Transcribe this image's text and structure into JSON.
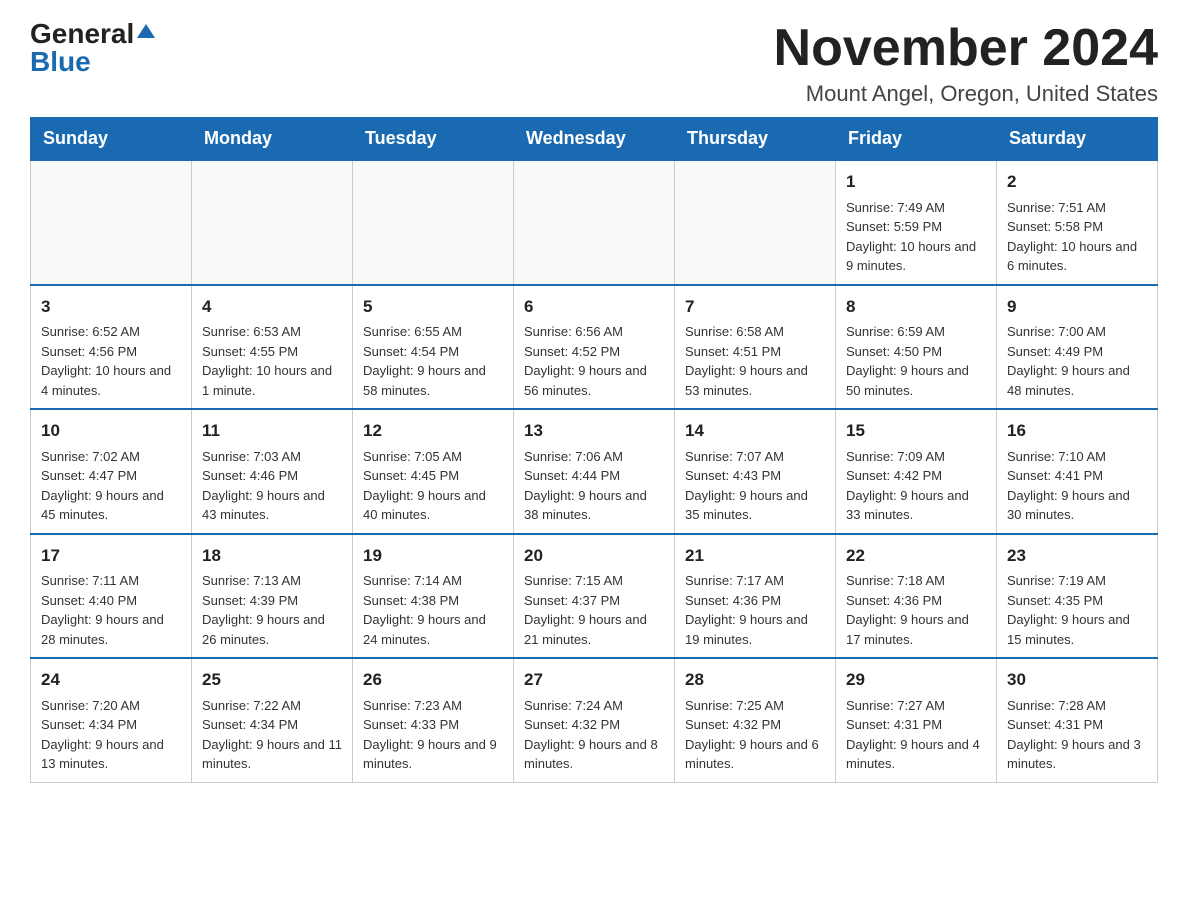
{
  "header": {
    "logo": {
      "general": "General",
      "blue": "Blue"
    },
    "month_title": "November 2024",
    "location": "Mount Angel, Oregon, United States"
  },
  "weekdays": [
    "Sunday",
    "Monday",
    "Tuesday",
    "Wednesday",
    "Thursday",
    "Friday",
    "Saturday"
  ],
  "weeks": [
    [
      {
        "day": "",
        "info": ""
      },
      {
        "day": "",
        "info": ""
      },
      {
        "day": "",
        "info": ""
      },
      {
        "day": "",
        "info": ""
      },
      {
        "day": "",
        "info": ""
      },
      {
        "day": "1",
        "info": "Sunrise: 7:49 AM\nSunset: 5:59 PM\nDaylight: 10 hours and 9 minutes."
      },
      {
        "day": "2",
        "info": "Sunrise: 7:51 AM\nSunset: 5:58 PM\nDaylight: 10 hours and 6 minutes."
      }
    ],
    [
      {
        "day": "3",
        "info": "Sunrise: 6:52 AM\nSunset: 4:56 PM\nDaylight: 10 hours and 4 minutes."
      },
      {
        "day": "4",
        "info": "Sunrise: 6:53 AM\nSunset: 4:55 PM\nDaylight: 10 hours and 1 minute."
      },
      {
        "day": "5",
        "info": "Sunrise: 6:55 AM\nSunset: 4:54 PM\nDaylight: 9 hours and 58 minutes."
      },
      {
        "day": "6",
        "info": "Sunrise: 6:56 AM\nSunset: 4:52 PM\nDaylight: 9 hours and 56 minutes."
      },
      {
        "day": "7",
        "info": "Sunrise: 6:58 AM\nSunset: 4:51 PM\nDaylight: 9 hours and 53 minutes."
      },
      {
        "day": "8",
        "info": "Sunrise: 6:59 AM\nSunset: 4:50 PM\nDaylight: 9 hours and 50 minutes."
      },
      {
        "day": "9",
        "info": "Sunrise: 7:00 AM\nSunset: 4:49 PM\nDaylight: 9 hours and 48 minutes."
      }
    ],
    [
      {
        "day": "10",
        "info": "Sunrise: 7:02 AM\nSunset: 4:47 PM\nDaylight: 9 hours and 45 minutes."
      },
      {
        "day": "11",
        "info": "Sunrise: 7:03 AM\nSunset: 4:46 PM\nDaylight: 9 hours and 43 minutes."
      },
      {
        "day": "12",
        "info": "Sunrise: 7:05 AM\nSunset: 4:45 PM\nDaylight: 9 hours and 40 minutes."
      },
      {
        "day": "13",
        "info": "Sunrise: 7:06 AM\nSunset: 4:44 PM\nDaylight: 9 hours and 38 minutes."
      },
      {
        "day": "14",
        "info": "Sunrise: 7:07 AM\nSunset: 4:43 PM\nDaylight: 9 hours and 35 minutes."
      },
      {
        "day": "15",
        "info": "Sunrise: 7:09 AM\nSunset: 4:42 PM\nDaylight: 9 hours and 33 minutes."
      },
      {
        "day": "16",
        "info": "Sunrise: 7:10 AM\nSunset: 4:41 PM\nDaylight: 9 hours and 30 minutes."
      }
    ],
    [
      {
        "day": "17",
        "info": "Sunrise: 7:11 AM\nSunset: 4:40 PM\nDaylight: 9 hours and 28 minutes."
      },
      {
        "day": "18",
        "info": "Sunrise: 7:13 AM\nSunset: 4:39 PM\nDaylight: 9 hours and 26 minutes."
      },
      {
        "day": "19",
        "info": "Sunrise: 7:14 AM\nSunset: 4:38 PM\nDaylight: 9 hours and 24 minutes."
      },
      {
        "day": "20",
        "info": "Sunrise: 7:15 AM\nSunset: 4:37 PM\nDaylight: 9 hours and 21 minutes."
      },
      {
        "day": "21",
        "info": "Sunrise: 7:17 AM\nSunset: 4:36 PM\nDaylight: 9 hours and 19 minutes."
      },
      {
        "day": "22",
        "info": "Sunrise: 7:18 AM\nSunset: 4:36 PM\nDaylight: 9 hours and 17 minutes."
      },
      {
        "day": "23",
        "info": "Sunrise: 7:19 AM\nSunset: 4:35 PM\nDaylight: 9 hours and 15 minutes."
      }
    ],
    [
      {
        "day": "24",
        "info": "Sunrise: 7:20 AM\nSunset: 4:34 PM\nDaylight: 9 hours and 13 minutes."
      },
      {
        "day": "25",
        "info": "Sunrise: 7:22 AM\nSunset: 4:34 PM\nDaylight: 9 hours and 11 minutes."
      },
      {
        "day": "26",
        "info": "Sunrise: 7:23 AM\nSunset: 4:33 PM\nDaylight: 9 hours and 9 minutes."
      },
      {
        "day": "27",
        "info": "Sunrise: 7:24 AM\nSunset: 4:32 PM\nDaylight: 9 hours and 8 minutes."
      },
      {
        "day": "28",
        "info": "Sunrise: 7:25 AM\nSunset: 4:32 PM\nDaylight: 9 hours and 6 minutes."
      },
      {
        "day": "29",
        "info": "Sunrise: 7:27 AM\nSunset: 4:31 PM\nDaylight: 9 hours and 4 minutes."
      },
      {
        "day": "30",
        "info": "Sunrise: 7:28 AM\nSunset: 4:31 PM\nDaylight: 9 hours and 3 minutes."
      }
    ]
  ]
}
